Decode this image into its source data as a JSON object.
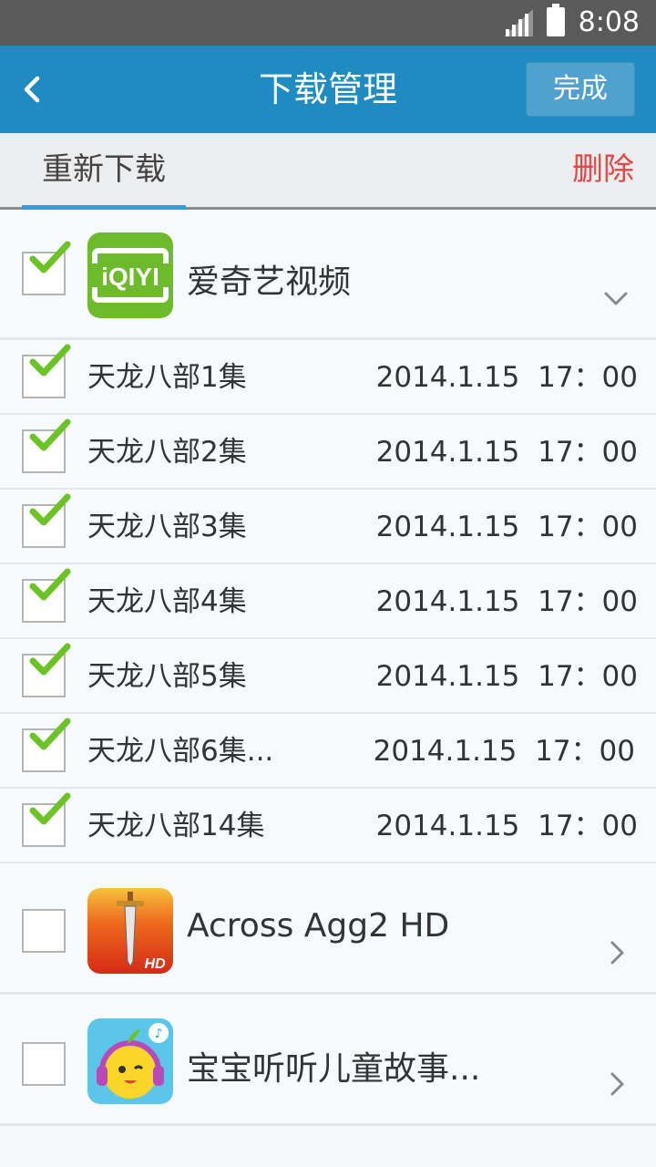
{
  "status_bar": {
    "time": "8:08"
  },
  "header": {
    "title": "下载管理",
    "done_label": "完成"
  },
  "toolbar": {
    "redownload_label": "重新下载",
    "delete_label": "删除"
  },
  "groups": [
    {
      "name": "爱奇艺视频",
      "icon": "iqiyi-app-icon",
      "icon_text": "iQIYI",
      "checked": true,
      "expanded": true,
      "episodes": [
        {
          "title": "天龙八部1集",
          "date": "2014.1.15  17：00",
          "checked": true
        },
        {
          "title": "天龙八部2集",
          "date": "2014.1.15  17：00",
          "checked": true
        },
        {
          "title": "天龙八部3集",
          "date": "2014.1.15  17：00",
          "checked": true
        },
        {
          "title": "天龙八部4集",
          "date": "2014.1.15  17：00",
          "checked": true
        },
        {
          "title": "天龙八部5集",
          "date": "2014.1.15  17：00",
          "checked": true
        },
        {
          "title": "天龙八部6集...",
          "date": "2014.1.15  17：00",
          "checked": true
        },
        {
          "title": "天龙八部14集",
          "date": "2014.1.15  17：00",
          "checked": true
        }
      ]
    },
    {
      "name": "Across Agg2 HD",
      "icon": "sword-game-app-icon",
      "icon_text": "HD",
      "checked": false,
      "expanded": false
    },
    {
      "name": "宝宝听听儿童故事...",
      "icon": "kids-story-app-icon",
      "checked": false,
      "expanded": false
    }
  ],
  "colors": {
    "primary": "#1e8bc1",
    "accent": "#2aa2d9",
    "delete": "#ee4343",
    "check": "#6cc326"
  }
}
